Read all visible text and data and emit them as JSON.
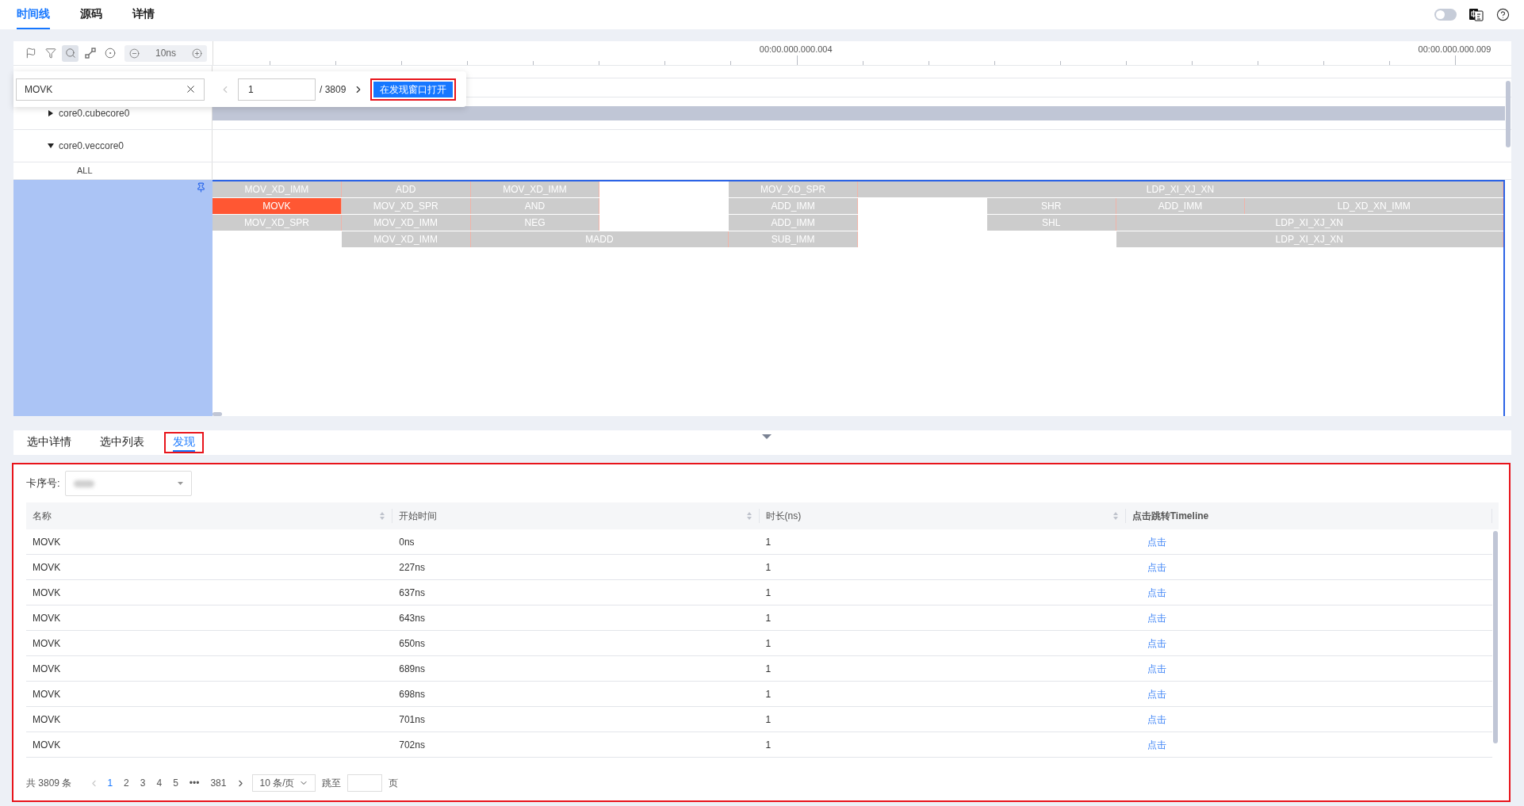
{
  "top_tabs": [
    {
      "label": "时间线",
      "selected": true
    },
    {
      "label": "源码",
      "selected": false
    },
    {
      "label": "详情",
      "selected": false
    }
  ],
  "top_toggle": {
    "on": false
  },
  "toolbar": {
    "tools": [
      {
        "kind": "flag",
        "selected": false
      },
      {
        "kind": "filter",
        "selected": false
      },
      {
        "kind": "search",
        "selected": true
      },
      {
        "kind": "link",
        "selected": false
      },
      {
        "kind": "target",
        "selected": false
      }
    ],
    "zoom_label": "10ns"
  },
  "ruler": {
    "labels": [
      "00:00.000.000.004",
      "00:00.000.000.009"
    ]
  },
  "search": {
    "value": "MOVK",
    "pager": [
      {
        "kind": "prev",
        "disabled": true
      },
      {
        "kind": "next",
        "disabled": false
      }
    ],
    "page_value": "1",
    "total": "/ 3809",
    "button": {
      "label": "在发现窗口打开",
      "highlighted": true
    }
  },
  "tree": [
    {
      "label": "core0.cubecore0",
      "expanded": false
    },
    {
      "label": "core0.veccore0",
      "expanded": true,
      "children": [
        {
          "label": "ALL"
        }
      ]
    }
  ],
  "lane_group": {
    "selected": true,
    "lanes": [
      [
        {
          "kind": "op",
          "label": "MOV_XD_IMM",
          "selected": false
        },
        {
          "kind": "op",
          "label": "ADD",
          "selected": false
        },
        {
          "kind": "op",
          "label": "MOV_XD_IMM",
          "selected": false
        },
        {
          "kind": "gap"
        },
        {
          "kind": "op",
          "label": "MOV_XD_SPR",
          "selected": false
        },
        {
          "kind": "op",
          "label": "LDP_XI_XJ_XN",
          "selected": false
        },
        {
          "kind": "continued"
        },
        {
          "kind": "continued"
        },
        {
          "kind": "continued"
        },
        {
          "kind": "continued"
        }
      ],
      [
        {
          "kind": "op",
          "label": "MOVK",
          "selected": true
        },
        {
          "kind": "op",
          "label": "MOV_XD_SPR",
          "selected": false
        },
        {
          "kind": "op",
          "label": "AND",
          "selected": false
        },
        {
          "kind": "gap"
        },
        {
          "kind": "op",
          "label": "ADD_IMM",
          "selected": false
        },
        {
          "kind": "gap"
        },
        {
          "kind": "op",
          "label": "SHR",
          "selected": false
        },
        {
          "kind": "op",
          "label": "ADD_IMM",
          "selected": false
        },
        {
          "kind": "op",
          "label": "LD_XD_XN_IMM",
          "selected": false
        },
        {
          "kind": "continued"
        }
      ],
      [
        {
          "kind": "op",
          "label": "MOV_XD_SPR",
          "selected": false
        },
        {
          "kind": "op",
          "label": "MOV_XD_IMM",
          "selected": false
        },
        {
          "kind": "op",
          "label": "NEG",
          "selected": false
        },
        {
          "kind": "gap"
        },
        {
          "kind": "op",
          "label": "ADD_IMM",
          "selected": false
        },
        {
          "kind": "gap"
        },
        {
          "kind": "op",
          "label": "SHL",
          "selected": false
        },
        {
          "kind": "op",
          "label": "LDP_XI_XJ_XN",
          "selected": false
        },
        {
          "kind": "continued"
        },
        {
          "kind": "continued"
        }
      ],
      [
        {
          "kind": "gap"
        },
        {
          "kind": "op",
          "label": "MOV_XD_IMM",
          "selected": false
        },
        {
          "kind": "op",
          "label": "MADD",
          "selected": false
        },
        {
          "kind": "continued"
        },
        {
          "kind": "op",
          "label": "SUB_IMM",
          "selected": false
        },
        {
          "kind": "gap"
        },
        {
          "kind": "gap"
        },
        {
          "kind": "op",
          "label": "LDP_XI_XJ_XN",
          "selected": false
        },
        {
          "kind": "continued"
        },
        {
          "kind": "continued"
        }
      ]
    ]
  },
  "bottom_tabs": [
    {
      "label": "选中详情",
      "selected": false,
      "highlighted": false
    },
    {
      "label": "选中列表",
      "selected": false,
      "highlighted": false
    },
    {
      "label": "发现",
      "selected": true,
      "highlighted": true
    }
  ],
  "find_panel": {
    "highlighted": true,
    "card_label": "卡序号:",
    "table": {
      "columns": [
        {
          "label": "名称",
          "sortable": true
        },
        {
          "label": "开始时间",
          "sortable": true
        },
        {
          "label": "时长(ns)",
          "sortable": true
        },
        {
          "label": "点击跳转Timeline",
          "sortable": false
        }
      ],
      "rows": [
        {
          "name": "MOVK",
          "start": "0ns",
          "duration": "1",
          "link": "点击"
        },
        {
          "name": "MOVK",
          "start": "227ns",
          "duration": "1",
          "link": "点击"
        },
        {
          "name": "MOVK",
          "start": "637ns",
          "duration": "1",
          "link": "点击"
        },
        {
          "name": "MOVK",
          "start": "643ns",
          "duration": "1",
          "link": "点击"
        },
        {
          "name": "MOVK",
          "start": "650ns",
          "duration": "1",
          "link": "点击"
        },
        {
          "name": "MOVK",
          "start": "689ns",
          "duration": "1",
          "link": "点击"
        },
        {
          "name": "MOVK",
          "start": "698ns",
          "duration": "1",
          "link": "点击"
        },
        {
          "name": "MOVK",
          "start": "701ns",
          "duration": "1",
          "link": "点击"
        },
        {
          "name": "MOVK",
          "start": "702ns",
          "duration": "1",
          "link": "点击"
        }
      ]
    },
    "pagination": {
      "total": "共 3809 条",
      "prev_disabled": true,
      "next_disabled": false,
      "pages": [
        {
          "label": "1",
          "selected": true
        },
        {
          "label": "2",
          "selected": false
        },
        {
          "label": "3",
          "selected": false
        },
        {
          "label": "4",
          "selected": false
        },
        {
          "label": "5",
          "selected": false
        },
        {
          "label": "•••",
          "selected": false
        },
        {
          "label": "381",
          "selected": false
        }
      ],
      "page_size": "10 条/页",
      "jump_label": "跳至",
      "page_suffix": "页"
    }
  }
}
